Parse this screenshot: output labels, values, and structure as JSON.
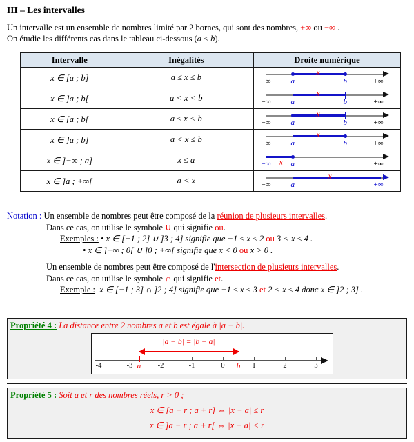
{
  "document": {
    "section_title": "III – Les intervalles",
    "intro_line1_a": "Un intervalle est un ensemble de nombres limité par 2 bornes, qui sont des nombres, ",
    "intro_line1_plus_inf": "+∞",
    "intro_line1_b": " ou ",
    "intro_line1_minus_inf": "−∞",
    "intro_line1_c": " .",
    "intro_line2_a": "On étudie les différents cas dans le tableau ci-dessous (",
    "intro_line2_cond": "a ≤ b",
    "intro_line2_b": ")."
  },
  "table": {
    "headers": [
      "Intervalle",
      "Inégalités",
      "Droite numérique"
    ],
    "rows": [
      {
        "interval": "x ∈ [a ; b]",
        "inequality": "a ≤ x ≤ b",
        "line": {
          "left_label": "−∞",
          "right_label": "+∞",
          "left_label_color": "#000000",
          "right_label_color": "#000000",
          "a_label": "a",
          "b_label": "b",
          "x_label": "x",
          "a_marker": "dot",
          "b_marker": "dot",
          "segment": "a-to-b"
        }
      },
      {
        "interval": "x ∈ ]a ; b[",
        "inequality": "a < x < b",
        "line": {
          "left_label": "−∞",
          "right_label": "+∞",
          "left_label_color": "#000000",
          "right_label_color": "#000000",
          "a_label": "a",
          "b_label": "b",
          "x_label": "x",
          "a_marker": "tick",
          "b_marker": "tick",
          "segment": "a-to-b"
        }
      },
      {
        "interval": "x ∈ [a ; b[",
        "inequality": "a ≤ x < b",
        "line": {
          "left_label": "−∞",
          "right_label": "+∞",
          "left_label_color": "#000000",
          "right_label_color": "#000000",
          "a_label": "a",
          "b_label": "b",
          "x_label": "x",
          "a_marker": "dot",
          "b_marker": "tick",
          "segment": "a-to-b"
        }
      },
      {
        "interval": "x ∈ ]a ; b]",
        "inequality": "a < x ≤ b",
        "line": {
          "left_label": "−∞",
          "right_label": "+∞",
          "left_label_color": "#000000",
          "right_label_color": "#000000",
          "a_label": "a",
          "b_label": "b",
          "x_label": "x",
          "a_marker": "tick",
          "b_marker": "dot",
          "segment": "a-to-b"
        }
      },
      {
        "interval": "x ∈ ]−∞ ; a]",
        "inequality": "x ≤ a",
        "line": {
          "left_label": "−∞",
          "right_label": "+∞",
          "left_label_color": "#0000cc",
          "right_label_color": "#000000",
          "a_label": "a",
          "b_label": "",
          "x_label": "x",
          "a_marker": "dot",
          "b_marker": "none",
          "segment": "left-to-a"
        }
      },
      {
        "interval": "x ∈ ]a ; +∞[",
        "inequality": "a < x",
        "line": {
          "left_label": "−∞",
          "right_label": "+∞",
          "left_label_color": "#000000",
          "right_label_color": "#0000cc",
          "a_label": "a",
          "b_label": "",
          "x_label": "x",
          "a_marker": "tick",
          "b_marker": "none",
          "segment": "a-to-right"
        }
      }
    ]
  },
  "notation": {
    "label": "Notation :",
    "union": {
      "line1_a": "Un ensemble de nombres peut être composé de la ",
      "line1_link": "réunion de plusieurs intervalles",
      "line1_b": ".",
      "line2_a": "Dans ce cas, on utilise le symbole ",
      "line2_symbol": "∪",
      "line2_b": " qui signifie ",
      "line2_word": "ou",
      "line2_c": ".",
      "examples_label": "Exemples :",
      "example1_a": "• x ∈ [−1 ; 2] ∪ ]3 ; 4]",
      "example1_b": "  signifie que  −1 ≤ x ≤ 2  ",
      "example1_word": "ou",
      "example1_c": "  3 < x ≤ 4 .",
      "example2_a": "• x ∈ ]−∞ ; 0[ ∪ ]0 ; +∞[",
      "example2_b": "  signifie que  x < 0  ",
      "example2_word": "ou",
      "example2_c": "  x > 0 ."
    },
    "intersection": {
      "line1_a": "Un ensemble de nombres peut être composé de l'",
      "line1_link": "intersection de plusieurs intervalles",
      "line1_b": ".",
      "line2_a": "Dans ce cas, on utilise le symbole ",
      "line2_symbol": "∩",
      "line2_b": " qui signifie ",
      "line2_word": "et",
      "line2_c": ".",
      "example_label": "Exemple :",
      "example_a": "x ∈ [−1 ; 3] ∩ ]2 ; 4]",
      "example_b": "  signifie que  −1 ≤ x ≤ 3  ",
      "example_word": "et",
      "example_c": "  2 < x ≤ 4  donc  x ∈ ]2 ; 3] ."
    }
  },
  "propriete4": {
    "tag": "Propriété 4 :",
    "body": "La distance entre 2 nombres a et b est égale à |a − b|.",
    "diagram": {
      "ticks": [
        "-4",
        "-3",
        "-2",
        "-1",
        "0",
        "1",
        "2",
        "3"
      ],
      "marker_a": "a",
      "marker_b": "b",
      "distance_label": "|a − b| = |b − a|"
    }
  },
  "propriete5": {
    "tag": "Propriété 5 :",
    "body": "Soit a et r des nombres réels, r > 0 ;",
    "formula1": "x ∈ [a − r ; a + r] ⇔ |x − a| ≤ r",
    "formula2": "x ∈ ]a − r ; a + r[ ⇔ |x − a| < r"
  },
  "colors": {
    "red": "#ee0000",
    "blue": "#0000cc",
    "green": "#008000",
    "header_bg": "#dce6f0",
    "box_bg": "#f0f0f0"
  }
}
